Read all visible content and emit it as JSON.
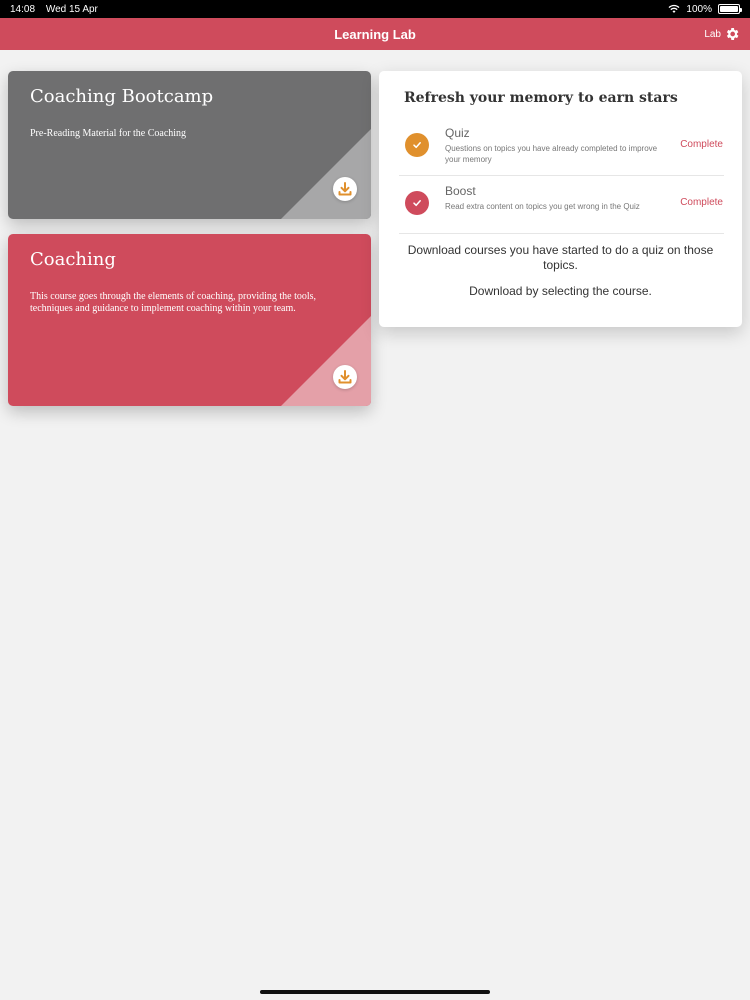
{
  "status_bar": {
    "time": "14:08",
    "date": "Wed 15 Apr",
    "battery": "100%"
  },
  "nav": {
    "title": "Learning Lab",
    "right_label": "Lab",
    "right_icon": "gear-icon"
  },
  "courses": [
    {
      "title": "Coaching Bootcamp",
      "description": "Pre-Reading Material for the Coaching",
      "icon": "download-icon"
    },
    {
      "title": "Coaching",
      "description": "This course goes through the elements of coaching, providing the tools, techniques and guidance to implement coaching within your team.",
      "icon": "download-icon"
    }
  ],
  "panel": {
    "title": "Refresh your memory to earn stars",
    "items": [
      {
        "name": "Quiz",
        "description": "Questions on topics you have already completed to improve your memory",
        "status": "Complete"
      },
      {
        "name": "Boost",
        "description": "Read extra content on topics you get wrong in the Quiz",
        "status": "Complete"
      }
    ],
    "text_1": "Download courses you have started to do a quiz on those topics.",
    "text_2": "Download by selecting the course."
  },
  "colors": {
    "accent": "#cf4b5c",
    "quiz": "#e0902d",
    "card_grey": "#6f6f70",
    "background": "#f2f2f2"
  }
}
